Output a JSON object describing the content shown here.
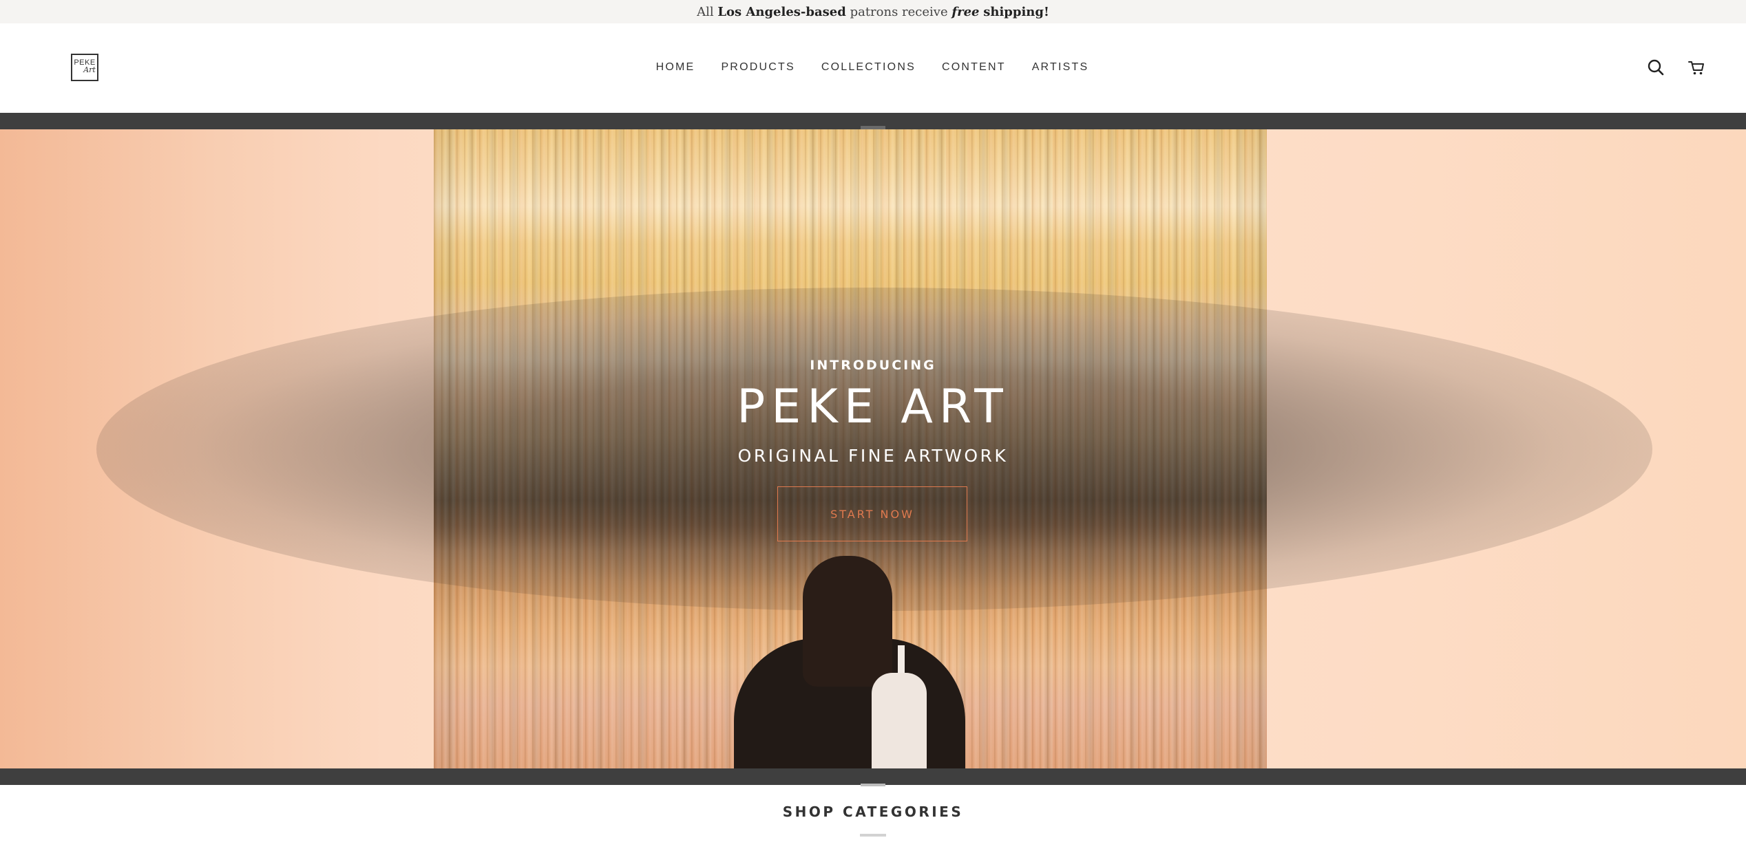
{
  "announcement": {
    "prefix": "All",
    "location": "Los Angeles-based",
    "middle": "patrons receive",
    "free": "free",
    "suffix": "shipping!"
  },
  "header": {
    "logo": {
      "line1": "PEKE",
      "line2": "Art"
    },
    "nav": [
      {
        "label": "HOME"
      },
      {
        "label": "PRODUCTS"
      },
      {
        "label": "COLLECTIONS"
      },
      {
        "label": "CONTENT"
      },
      {
        "label": "ARTISTS"
      }
    ],
    "icons": {
      "search": "search-icon",
      "cart": "cart-icon"
    }
  },
  "hero": {
    "kicker": "INTRODUCING",
    "title": "PEKE ART",
    "subtitle": "ORIGINAL FINE ARTWORK",
    "button": "START NOW",
    "colors": {
      "button_accent": "#e07a4f",
      "band": "#3f3f3f"
    }
  },
  "sections": {
    "shop_categories": "SHOP CATEGORIES"
  }
}
